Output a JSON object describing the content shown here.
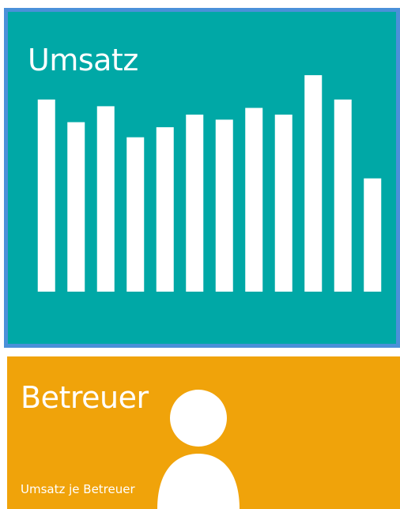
{
  "tiles": {
    "umsatz": {
      "title": "Umsatz",
      "color": "#00a8a6",
      "border_color": "#4a90d9",
      "icon": "bar-chart-icon"
    },
    "betreuer": {
      "title": "Betreuer",
      "subtitle": "Umsatz je Betreuer",
      "color": "#f0a30a",
      "icon": "person-icon"
    }
  },
  "chart_data": {
    "type": "bar",
    "values": [
      229,
      202,
      221,
      184,
      196,
      211,
      205,
      219,
      211,
      258,
      229,
      135
    ],
    "ylim": [
      0,
      260
    ],
    "color": "#ffffff",
    "grid": false,
    "legend": "none"
  }
}
